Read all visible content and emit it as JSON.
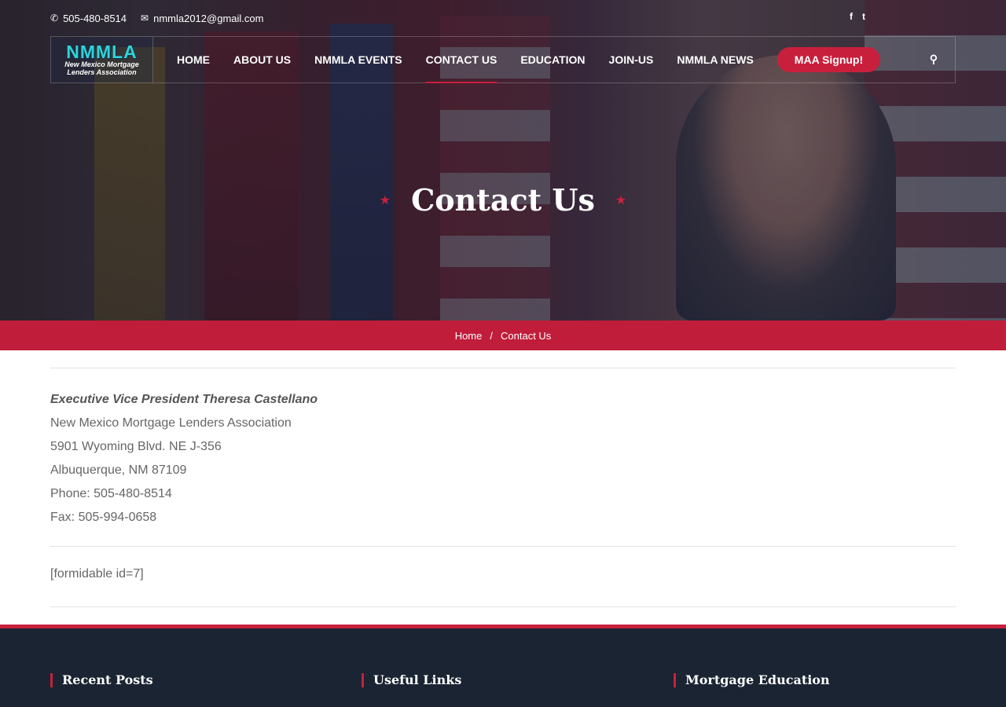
{
  "topbar": {
    "phone": "505-480-8514",
    "email": "nmmla2012@gmail.com"
  },
  "social": {
    "facebook": "f",
    "twitter": "t"
  },
  "logo": {
    "line1": "NMMLA",
    "line2": "New Mexico Mortgage",
    "line3": "Lenders Association"
  },
  "nav": {
    "items": [
      "HOME",
      "ABOUT US",
      "NMMLA EVENTS",
      "CONTACT US",
      "EDUCATION",
      "JOIN-US",
      "NMMLA NEWS"
    ],
    "active": "CONTACT US",
    "signup": "MAA Signup!"
  },
  "hero": {
    "title": "Contact Us"
  },
  "breadcrumb": {
    "home": "Home",
    "sep": "/",
    "current": "Contact Us"
  },
  "contact": {
    "exec": "Executive Vice President Theresa Castellano",
    "org": "New Mexico Mortgage Lenders Association",
    "address": "5901 Wyoming Blvd. NE J-356",
    "city": "Albuquerque, NM  87109",
    "phone": "Phone: 505-480-8514",
    "fax": "Fax: 505-994-0658"
  },
  "shortcode": "[formidable id=7]",
  "footer": {
    "col1": "Recent Posts",
    "col2": "Useful Links",
    "col3": "Mortgage Education"
  },
  "colors": {
    "accent": "#c8203c",
    "footer_bg": "#1b2433"
  }
}
